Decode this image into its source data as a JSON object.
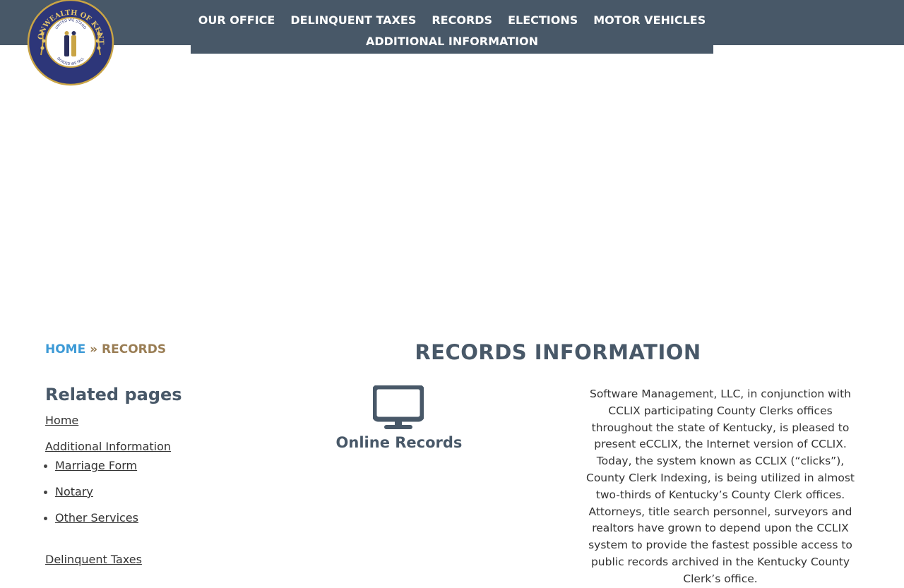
{
  "header": {
    "logo_icon": "kentucky-state-seal",
    "seal_text_top": "COMMONWEALTH OF KENTUCKY",
    "seal_text_inner_top": "UNITED WE STAND",
    "seal_text_inner_bottom": "DIVIDED WE FALL",
    "nav_row1": [
      "OUR OFFICE",
      "DELINQUENT TAXES",
      "RECORDS",
      "ELECTIONS",
      "MOTOR VEHICLES"
    ],
    "nav_row2": [
      "ADDITIONAL INFORMATION"
    ],
    "bar_color": "#485868"
  },
  "breadcrumb": {
    "home": "HOME",
    "separator": "»",
    "current": "RECORDS",
    "link_color": "#3d9ad6",
    "current_color": "#9a7e55"
  },
  "sidebar": {
    "title": "Related pages",
    "home": "Home",
    "additional": "Additional Information",
    "sub_items": [
      "Marriage Form",
      "Notary",
      "Other Services"
    ],
    "delinquent": "Delinquent Taxes"
  },
  "main": {
    "title": "RECORDS INFORMATION",
    "online_icon": "monitor-icon",
    "online_label": "Online Records",
    "description": "Software Management, LLC, in conjunction with CCLIX participating County Clerks offices throughout the state of Kentucky, is pleased to present eCCLIX, the Internet version of CCLIX. Today, the system known as CCLIX (“clicks”), County Clerk Indexing, is being utilized in almost two-thirds of Kentucky’s County Clerk offices. Attorneys, title search personnel, surveyors and realtors have grown to depend upon the CCLIX system to provide the fastest possible access to public records archived in the Kentucky County Clerk’s office."
  }
}
